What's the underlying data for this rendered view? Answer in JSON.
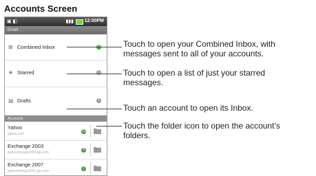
{
  "heading": "Accounts Screen",
  "status_bar": {
    "time": "12:00PM"
  },
  "header_title": "Email",
  "mailboxes": [
    {
      "label": "Combined Inbox",
      "count": "19",
      "icon": "inbox-icon",
      "badge_color": "#3c9e2f"
    },
    {
      "label": "Starred",
      "count": "1",
      "icon": "star-icon",
      "badge_color": "#999999"
    },
    {
      "label": "Drafts",
      "count": "1",
      "icon": "drafts-icon",
      "badge_color": "#999999"
    }
  ],
  "accounts_section": "Accounts",
  "accounts": [
    {
      "name": "Yahoo",
      "email": "yahoo.com",
      "count": "21"
    },
    {
      "name": "Exchange 2003",
      "email": "ppdexchange2003.lge.com",
      "count": "8"
    },
    {
      "name": "Exchange 2007",
      "email": "ppdexchange2007.lge.com",
      "count": "2"
    }
  ],
  "callouts": [
    {
      "line1": "Touch to open your Combined Inbox, with",
      "line2": "messages sent to all of your accounts."
    },
    {
      "line1": "Touch to open a list of just your starred",
      "line2": "messages."
    },
    {
      "line1": "Touch an account to open its Inbox."
    },
    {
      "line1": "Touch the folder icon to open the account’s",
      "line2": "folders."
    }
  ]
}
